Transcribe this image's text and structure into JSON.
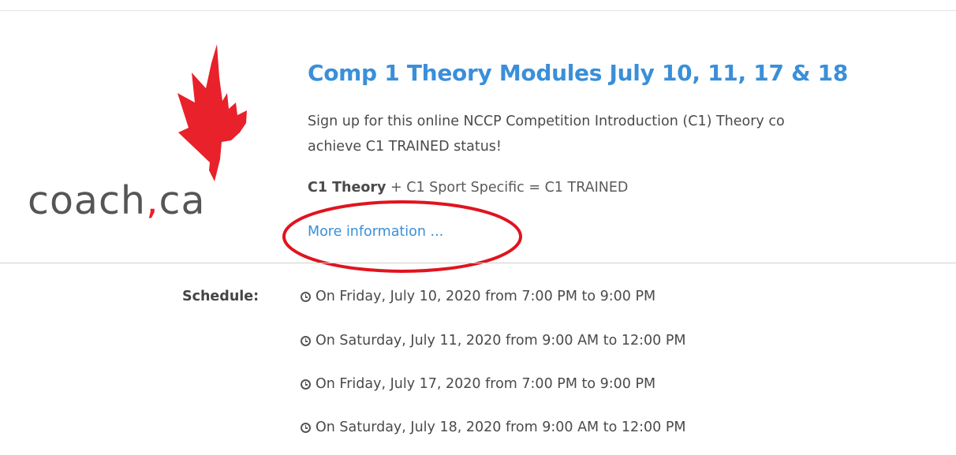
{
  "event": {
    "logo_text": "coach",
    "logo_comma": ",",
    "logo_suffix": "ca",
    "title": "Comp 1 Theory Modules July 10, 11, 17 & 18",
    "description_line1": "Sign up for this online NCCP Competition Introduction (C1) Theory co",
    "description_line2": "achieve C1 TRAINED status!",
    "formula_bold": "C1 Theory",
    "formula_rest": " + C1 Sport Specific = C1 TRAINED",
    "more_link": "More information ...",
    "highlight_color": "#e0141e"
  },
  "schedule": {
    "label": "Schedule:",
    "items": [
      "On Friday, July 10, 2020 from 7:00 PM to 9:00 PM",
      "On Saturday, July 11, 2020 from 9:00 AM to 12:00 PM",
      "On Friday, July 17, 2020 from 7:00 PM to 9:00 PM",
      "On Saturday, July 18, 2020 from 9:00 AM to 12:00 PM"
    ],
    "icon": "clock-icon"
  },
  "colors": {
    "link": "#3a8fd9",
    "maple_leaf": "#e8212a",
    "text": "#4a4a4a"
  }
}
